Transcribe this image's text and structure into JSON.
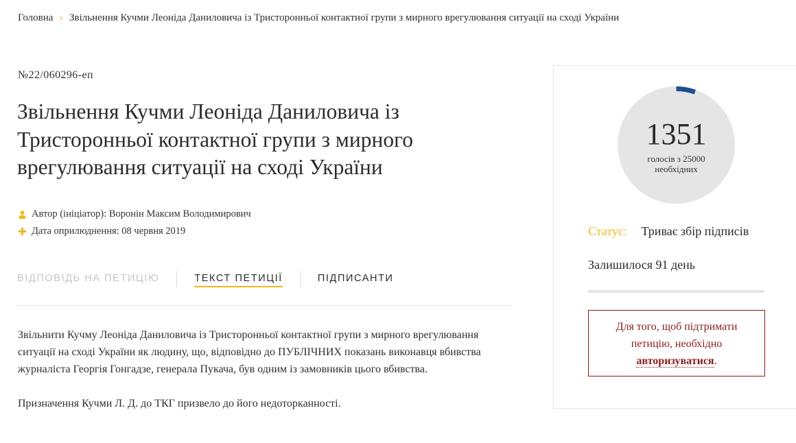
{
  "breadcrumb": {
    "home": "Головна",
    "separator": "›",
    "current": "Звільнення Кучми Леоніда Даниловича із Тристоронньої контактної групи з мирного врегулювання ситуації на сході України"
  },
  "petition": {
    "number": "№22/060296-еп",
    "title": "Звільнення Кучми Леоніда Даниловича із Тристоронньої контактної групи з мирного врегулювання ситуації на сході України",
    "meta": {
      "author": "Автор (ініціатор): Воронін Максим Володимирович",
      "author_icon": "user-icon",
      "date": "Дата оприлюднення: 08 червня 2019",
      "date_icon": "plus-icon"
    },
    "tabs": [
      {
        "label": "Відповідь на петицію",
        "state": "disabled"
      },
      {
        "label": "Текст петиції",
        "state": "active"
      },
      {
        "label": "Підписанти",
        "state": "normal"
      }
    ],
    "body": [
      "Звільнити Кучму Леоніда Даниловича із Тристоронньої контактної групи з мирного врегулювання ситуації на сході України як людину, що, відповідно до ПУБЛІЧНИХ показань виконавця вбивства журналіста Георгія Гонгадзе, генерала Пукача, був одним із замовників цього вбивства.",
      "Призначення Кучми Л. Д. до ТКГ призвело до його недоторканності."
    ]
  },
  "sidebar": {
    "votes": {
      "count": "1351",
      "count_value": 1351,
      "target_value": 25000,
      "caption_line1": "голосів з 25000",
      "caption_line2": "необхідних"
    },
    "status_label": "Статус:",
    "status_value": "Триває збір підписів",
    "remaining": "Залишилося 91 день",
    "progress_fraction": 0.0,
    "auth": {
      "text_before": "Для того, щоб підтримати петицію, необхідно",
      "link": "авторизуватися",
      "text_after": "."
    }
  },
  "colors": {
    "accent": "#f0b81e",
    "progress": "#1d4f91",
    "circle_bg": "#e5e5e5",
    "auth": "#8b1a1a",
    "tab_disabled": "#c6c6c6"
  }
}
